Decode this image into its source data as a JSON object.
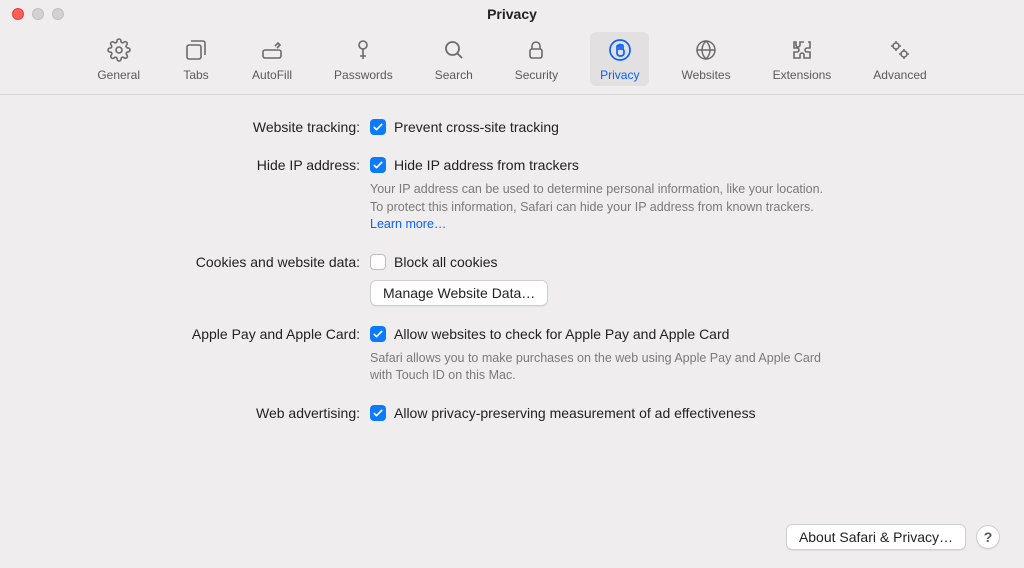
{
  "window_title": "Privacy",
  "tabs": {
    "general": "General",
    "tabs": "Tabs",
    "autofill": "AutoFill",
    "passwords": "Passwords",
    "search": "Search",
    "security": "Security",
    "privacy": "Privacy",
    "websites": "Websites",
    "extensions": "Extensions",
    "advanced": "Advanced"
  },
  "sections": {
    "tracking": {
      "label": "Website tracking:",
      "checkbox_label": "Prevent cross-site tracking",
      "checked": true
    },
    "hide_ip": {
      "label": "Hide IP address:",
      "checkbox_label": "Hide IP address from trackers",
      "checked": true,
      "desc": "Your IP address can be used to determine personal information, like your location. To protect this information, Safari can hide your IP address from known trackers. ",
      "learn_more": "Learn more…"
    },
    "cookies": {
      "label": "Cookies and website data:",
      "checkbox_label": "Block all cookies",
      "checked": false,
      "button": "Manage Website Data…"
    },
    "apple_pay": {
      "label": "Apple Pay and Apple Card:",
      "checkbox_label": "Allow websites to check for Apple Pay and Apple Card",
      "checked": true,
      "desc": "Safari allows you to make purchases on the web using Apple Pay and Apple Card with Touch ID on this Mac."
    },
    "web_ads": {
      "label": "Web advertising:",
      "checkbox_label": "Allow privacy-preserving measurement of ad effectiveness",
      "checked": true
    }
  },
  "footer": {
    "about": "About Safari & Privacy…",
    "help": "?"
  }
}
